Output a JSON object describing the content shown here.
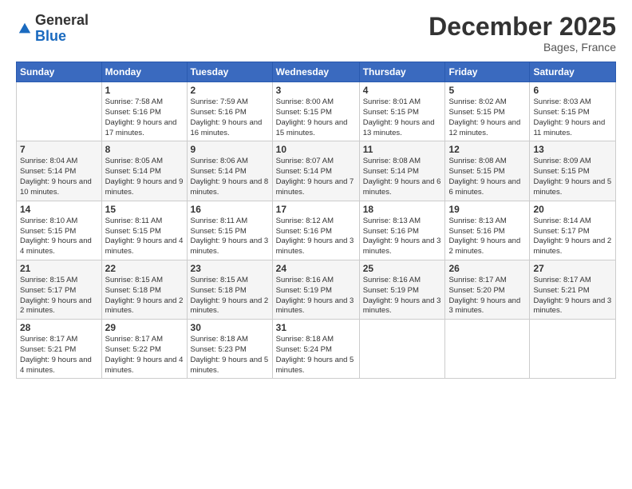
{
  "logo": {
    "general": "General",
    "blue": "Blue"
  },
  "header": {
    "month": "December 2025",
    "location": "Bages, France"
  },
  "weekdays": [
    "Sunday",
    "Monday",
    "Tuesday",
    "Wednesday",
    "Thursday",
    "Friday",
    "Saturday"
  ],
  "weeks": [
    [
      {
        "num": "",
        "sunrise": "",
        "sunset": "",
        "daylight": ""
      },
      {
        "num": "1",
        "sunrise": "Sunrise: 7:58 AM",
        "sunset": "Sunset: 5:16 PM",
        "daylight": "Daylight: 9 hours and 17 minutes."
      },
      {
        "num": "2",
        "sunrise": "Sunrise: 7:59 AM",
        "sunset": "Sunset: 5:16 PM",
        "daylight": "Daylight: 9 hours and 16 minutes."
      },
      {
        "num": "3",
        "sunrise": "Sunrise: 8:00 AM",
        "sunset": "Sunset: 5:15 PM",
        "daylight": "Daylight: 9 hours and 15 minutes."
      },
      {
        "num": "4",
        "sunrise": "Sunrise: 8:01 AM",
        "sunset": "Sunset: 5:15 PM",
        "daylight": "Daylight: 9 hours and 13 minutes."
      },
      {
        "num": "5",
        "sunrise": "Sunrise: 8:02 AM",
        "sunset": "Sunset: 5:15 PM",
        "daylight": "Daylight: 9 hours and 12 minutes."
      },
      {
        "num": "6",
        "sunrise": "Sunrise: 8:03 AM",
        "sunset": "Sunset: 5:15 PM",
        "daylight": "Daylight: 9 hours and 11 minutes."
      }
    ],
    [
      {
        "num": "7",
        "sunrise": "Sunrise: 8:04 AM",
        "sunset": "Sunset: 5:14 PM",
        "daylight": "Daylight: 9 hours and 10 minutes."
      },
      {
        "num": "8",
        "sunrise": "Sunrise: 8:05 AM",
        "sunset": "Sunset: 5:14 PM",
        "daylight": "Daylight: 9 hours and 9 minutes."
      },
      {
        "num": "9",
        "sunrise": "Sunrise: 8:06 AM",
        "sunset": "Sunset: 5:14 PM",
        "daylight": "Daylight: 9 hours and 8 minutes."
      },
      {
        "num": "10",
        "sunrise": "Sunrise: 8:07 AM",
        "sunset": "Sunset: 5:14 PM",
        "daylight": "Daylight: 9 hours and 7 minutes."
      },
      {
        "num": "11",
        "sunrise": "Sunrise: 8:08 AM",
        "sunset": "Sunset: 5:14 PM",
        "daylight": "Daylight: 9 hours and 6 minutes."
      },
      {
        "num": "12",
        "sunrise": "Sunrise: 8:08 AM",
        "sunset": "Sunset: 5:15 PM",
        "daylight": "Daylight: 9 hours and 6 minutes."
      },
      {
        "num": "13",
        "sunrise": "Sunrise: 8:09 AM",
        "sunset": "Sunset: 5:15 PM",
        "daylight": "Daylight: 9 hours and 5 minutes."
      }
    ],
    [
      {
        "num": "14",
        "sunrise": "Sunrise: 8:10 AM",
        "sunset": "Sunset: 5:15 PM",
        "daylight": "Daylight: 9 hours and 4 minutes."
      },
      {
        "num": "15",
        "sunrise": "Sunrise: 8:11 AM",
        "sunset": "Sunset: 5:15 PM",
        "daylight": "Daylight: 9 hours and 4 minutes."
      },
      {
        "num": "16",
        "sunrise": "Sunrise: 8:11 AM",
        "sunset": "Sunset: 5:15 PM",
        "daylight": "Daylight: 9 hours and 3 minutes."
      },
      {
        "num": "17",
        "sunrise": "Sunrise: 8:12 AM",
        "sunset": "Sunset: 5:16 PM",
        "daylight": "Daylight: 9 hours and 3 minutes."
      },
      {
        "num": "18",
        "sunrise": "Sunrise: 8:13 AM",
        "sunset": "Sunset: 5:16 PM",
        "daylight": "Daylight: 9 hours and 3 minutes."
      },
      {
        "num": "19",
        "sunrise": "Sunrise: 8:13 AM",
        "sunset": "Sunset: 5:16 PM",
        "daylight": "Daylight: 9 hours and 2 minutes."
      },
      {
        "num": "20",
        "sunrise": "Sunrise: 8:14 AM",
        "sunset": "Sunset: 5:17 PM",
        "daylight": "Daylight: 9 hours and 2 minutes."
      }
    ],
    [
      {
        "num": "21",
        "sunrise": "Sunrise: 8:15 AM",
        "sunset": "Sunset: 5:17 PM",
        "daylight": "Daylight: 9 hours and 2 minutes."
      },
      {
        "num": "22",
        "sunrise": "Sunrise: 8:15 AM",
        "sunset": "Sunset: 5:18 PM",
        "daylight": "Daylight: 9 hours and 2 minutes."
      },
      {
        "num": "23",
        "sunrise": "Sunrise: 8:15 AM",
        "sunset": "Sunset: 5:18 PM",
        "daylight": "Daylight: 9 hours and 2 minutes."
      },
      {
        "num": "24",
        "sunrise": "Sunrise: 8:16 AM",
        "sunset": "Sunset: 5:19 PM",
        "daylight": "Daylight: 9 hours and 3 minutes."
      },
      {
        "num": "25",
        "sunrise": "Sunrise: 8:16 AM",
        "sunset": "Sunset: 5:19 PM",
        "daylight": "Daylight: 9 hours and 3 minutes."
      },
      {
        "num": "26",
        "sunrise": "Sunrise: 8:17 AM",
        "sunset": "Sunset: 5:20 PM",
        "daylight": "Daylight: 9 hours and 3 minutes."
      },
      {
        "num": "27",
        "sunrise": "Sunrise: 8:17 AM",
        "sunset": "Sunset: 5:21 PM",
        "daylight": "Daylight: 9 hours and 3 minutes."
      }
    ],
    [
      {
        "num": "28",
        "sunrise": "Sunrise: 8:17 AM",
        "sunset": "Sunset: 5:21 PM",
        "daylight": "Daylight: 9 hours and 4 minutes."
      },
      {
        "num": "29",
        "sunrise": "Sunrise: 8:17 AM",
        "sunset": "Sunset: 5:22 PM",
        "daylight": "Daylight: 9 hours and 4 minutes."
      },
      {
        "num": "30",
        "sunrise": "Sunrise: 8:18 AM",
        "sunset": "Sunset: 5:23 PM",
        "daylight": "Daylight: 9 hours and 5 minutes."
      },
      {
        "num": "31",
        "sunrise": "Sunrise: 8:18 AM",
        "sunset": "Sunset: 5:24 PM",
        "daylight": "Daylight: 9 hours and 5 minutes."
      },
      {
        "num": "",
        "sunrise": "",
        "sunset": "",
        "daylight": ""
      },
      {
        "num": "",
        "sunrise": "",
        "sunset": "",
        "daylight": ""
      },
      {
        "num": "",
        "sunrise": "",
        "sunset": "",
        "daylight": ""
      }
    ]
  ]
}
